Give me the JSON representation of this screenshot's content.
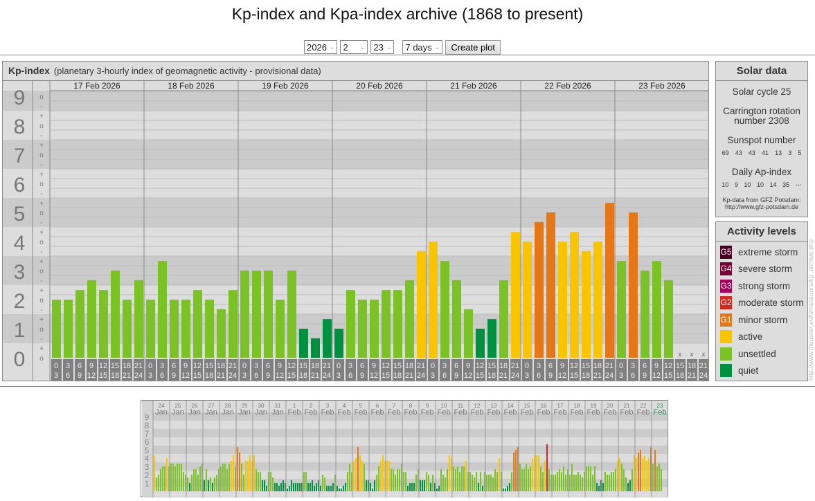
{
  "title": "Kp-index and Kpa-index archive (1868 to present)",
  "controls": {
    "year": "2026",
    "month": "2",
    "day": "23",
    "range": "7 days",
    "create": "Create plot"
  },
  "kp_panel": {
    "heading": "Kp-index",
    "subtitle": "(planetary 3-hourly index of geomagnetic activity - provisional data)"
  },
  "solar": {
    "heading": "Solar data",
    "cycle": "Solar cycle 25",
    "carrington": "Carrington rotation number 2308",
    "sunspot_label": "Sunspot number",
    "sunspots": [
      "69",
      "43",
      "43",
      "41",
      "13",
      "3",
      "5"
    ],
    "ap_label": "Daily Ap-index",
    "ap": [
      "10",
      "9",
      "10",
      "10",
      "14",
      "35",
      "---"
    ],
    "source1": "Kp-data from GFZ Potsdam:",
    "source2": "http://www.gfz-potsdam.de"
  },
  "activity": {
    "heading": "Activity levels",
    "levels": [
      {
        "code": "G5",
        "label": "extreme storm",
        "color": "#4a0025"
      },
      {
        "code": "G4",
        "label": "severe storm",
        "color": "#7a0035"
      },
      {
        "code": "G3",
        "label": "strong storm",
        "color": "#a8005a"
      },
      {
        "code": "G2",
        "label": "moderate storm",
        "color": "#d9261c"
      },
      {
        "code": "G1",
        "label": "minor storm",
        "color": "#e57717"
      },
      {
        "code": "",
        "label": "active",
        "color": "#f8c500"
      },
      {
        "code": "",
        "label": "unsettled",
        "color": "#7bc225"
      },
      {
        "code": "",
        "label": "quiet",
        "color": "#009140"
      }
    ]
  },
  "side_url": "http://www.theusner.eu/terra/aurora/kp_archive.php",
  "chart_data": [
    {
      "type": "bar",
      "title": "Kp-index",
      "ylabel": "Kp",
      "ylim": [
        0,
        9
      ],
      "y_ticks": [
        "0",
        "1",
        "2",
        "3",
        "4",
        "5",
        "6",
        "7",
        "8",
        "9"
      ],
      "sub_ticks": [
        "+",
        "o",
        "-"
      ],
      "hour_labels": [
        [
          "0",
          "3"
        ],
        [
          "3",
          "6"
        ],
        [
          "6",
          "9"
        ],
        [
          "9",
          "12"
        ],
        [
          "12",
          "15"
        ],
        [
          "15",
          "18"
        ],
        [
          "18",
          "21"
        ],
        [
          "21",
          "24"
        ]
      ],
      "missing_label": "x",
      "days": [
        {
          "date": "17 Feb 2026",
          "kp": [
            2,
            2,
            2.33,
            2.67,
            2.33,
            3,
            2,
            2.67
          ]
        },
        {
          "date": "18 Feb 2026",
          "kp": [
            2,
            3.33,
            2,
            2,
            2.33,
            2,
            1.67,
            2.33
          ]
        },
        {
          "date": "19 Feb 2026",
          "kp": [
            3,
            3,
            3,
            2,
            3,
            1,
            0.67,
            1.33
          ]
        },
        {
          "date": "20 Feb 2026",
          "kp": [
            1,
            2.33,
            2,
            2,
            2.33,
            2.33,
            2.67,
            3.67
          ]
        },
        {
          "date": "21 Feb 2026",
          "kp": [
            4,
            3.33,
            2.67,
            1.67,
            1,
            1.33,
            2.67,
            4.33
          ]
        },
        {
          "date": "22 Feb 2026",
          "kp": [
            4,
            4.67,
            5,
            4,
            4.33,
            3.67,
            4,
            5.33
          ]
        },
        {
          "date": "23 Feb 2026",
          "kp": [
            3.33,
            5,
            3,
            3.33,
            2.67,
            null,
            null,
            null
          ]
        }
      ]
    },
    {
      "type": "bar",
      "title": "Kp-index last 31 days",
      "ylim": [
        0,
        9
      ],
      "y_ticks": [
        "1",
        "2",
        "3",
        "4",
        "5",
        "6",
        "7",
        "8",
        "9"
      ],
      "days": [
        {
          "d": "24",
          "m": "Jan",
          "kp": [
            4.33,
            1.67,
            2,
            2.67,
            3,
            3,
            4,
            3
          ]
        },
        {
          "d": "25",
          "m": "Jan",
          "kp": [
            3.33,
            3.33,
            3,
            3.33,
            3.33,
            3.33,
            2.33,
            2
          ]
        },
        {
          "d": "26",
          "m": "Jan",
          "kp": [
            1.67,
            1,
            2,
            2.67,
            2.67,
            2,
            3,
            3.33
          ]
        },
        {
          "d": "27",
          "m": "Jan",
          "kp": [
            1.33,
            2.67,
            1.33,
            1.67,
            1,
            1.67,
            2,
            2.67
          ]
        },
        {
          "d": "28",
          "m": "Jan",
          "kp": [
            3,
            3.33,
            3.33,
            2.67,
            3.33,
            3.67,
            4.33,
            3
          ]
        },
        {
          "d": "29",
          "m": "Jan",
          "kp": [
            5.33,
            4.67,
            3.33,
            2,
            3.67,
            3.67,
            4.33,
            3.67
          ]
        },
        {
          "d": "30",
          "m": "Jan",
          "kp": [
            4.33,
            2.67,
            2.33,
            2.33,
            1.33,
            1.33,
            0.67,
            2.33
          ]
        },
        {
          "d": "31",
          "m": "Jan",
          "kp": [
            2.33,
            1.67,
            1,
            1,
            0.67,
            1,
            1.33,
            1
          ]
        },
        {
          "d": "1",
          "m": "Feb",
          "kp": [
            0.33,
            0.67,
            1.33,
            1,
            1,
            1,
            1,
            1
          ]
        },
        {
          "d": "2",
          "m": "Feb",
          "kp": [
            2.33,
            2.33,
            1,
            1,
            1.33,
            0.67,
            1,
            1.33
          ]
        },
        {
          "d": "3",
          "m": "Feb",
          "kp": [
            0.67,
            2,
            1.67,
            0.67,
            0.67,
            0.67,
            1,
            2
          ]
        },
        {
          "d": "4",
          "m": "Feb",
          "kp": [
            0.67,
            0.33,
            0.33,
            0.67,
            1,
            2.33,
            3.33,
            2.33
          ]
        },
        {
          "d": "5",
          "m": "Feb",
          "kp": [
            3.67,
            4,
            5.33,
            4.33,
            3.67,
            3.33,
            1.33,
            1.33
          ]
        },
        {
          "d": "6",
          "m": "Feb",
          "kp": [
            1,
            0.33,
            1.33,
            2,
            3,
            3.67,
            4.33,
            3.67
          ]
        },
        {
          "d": "7",
          "m": "Feb",
          "kp": [
            3.67,
            3.67,
            2.67,
            2.67,
            2,
            2.67,
            2.67,
            3.33
          ]
        },
        {
          "d": "8",
          "m": "Feb",
          "kp": [
            2.33,
            2.33,
            0.67,
            1,
            1,
            1,
            2,
            2.67
          ]
        },
        {
          "d": "9",
          "m": "Feb",
          "kp": [
            1.33,
            1.33,
            1.33,
            2.33,
            2,
            1,
            2,
            1
          ]
        },
        {
          "d": "10",
          "m": "Feb",
          "kp": [
            0.33,
            0.67,
            2.67,
            2,
            1.67,
            2.67,
            4.33,
            4
          ]
        },
        {
          "d": "11",
          "m": "Feb",
          "kp": [
            3,
            2.67,
            3,
            2.33,
            3,
            3,
            3.67,
            2.33
          ]
        },
        {
          "d": "12",
          "m": "Feb",
          "kp": [
            2.33,
            2,
            1.67,
            2.33,
            1,
            2.33,
            0.67,
            2.33
          ]
        },
        {
          "d": "13",
          "m": "Feb",
          "kp": [
            2,
            2,
            2,
            1.67,
            2.67,
            2.33,
            4,
            2.33
          ]
        },
        {
          "d": "14",
          "m": "Feb",
          "kp": [
            0.33,
            0.33,
            0.67,
            1,
            2.33,
            4.67,
            5,
            5.33
          ]
        },
        {
          "d": "15",
          "m": "Feb",
          "kp": [
            3.33,
            2.67,
            2.67,
            3.33,
            2.67,
            3,
            4,
            4.33
          ]
        },
        {
          "d": "16",
          "m": "Feb",
          "kp": [
            4.33,
            4.33,
            3,
            2.33,
            3.67,
            5.67,
            2.67,
            2
          ]
        },
        {
          "d": "17",
          "m": "Feb",
          "kp": [
            2,
            2,
            2.33,
            2.67,
            2.33,
            3,
            2,
            2.67
          ]
        },
        {
          "d": "18",
          "m": "Feb",
          "kp": [
            2,
            3.33,
            2,
            2,
            2.33,
            2,
            1.67,
            2.33
          ]
        },
        {
          "d": "19",
          "m": "Feb",
          "kp": [
            3,
            3,
            3,
            2,
            3,
            1,
            0.67,
            1.33
          ]
        },
        {
          "d": "20",
          "m": "Feb",
          "kp": [
            1,
            2.33,
            2,
            2,
            2.33,
            2.33,
            2.67,
            3.67
          ]
        },
        {
          "d": "21",
          "m": "Feb",
          "kp": [
            4,
            3.33,
            2.67,
            1.67,
            1,
            1.33,
            2.67,
            4.33
          ]
        },
        {
          "d": "22",
          "m": "Feb",
          "kp": [
            4,
            4.67,
            5,
            4,
            4.33,
            3.67,
            4,
            5.33
          ]
        },
        {
          "d": "23",
          "m": "Feb",
          "kp": [
            3.33,
            5,
            3,
            3.33,
            2.67,
            null,
            null,
            null
          ]
        }
      ]
    }
  ]
}
